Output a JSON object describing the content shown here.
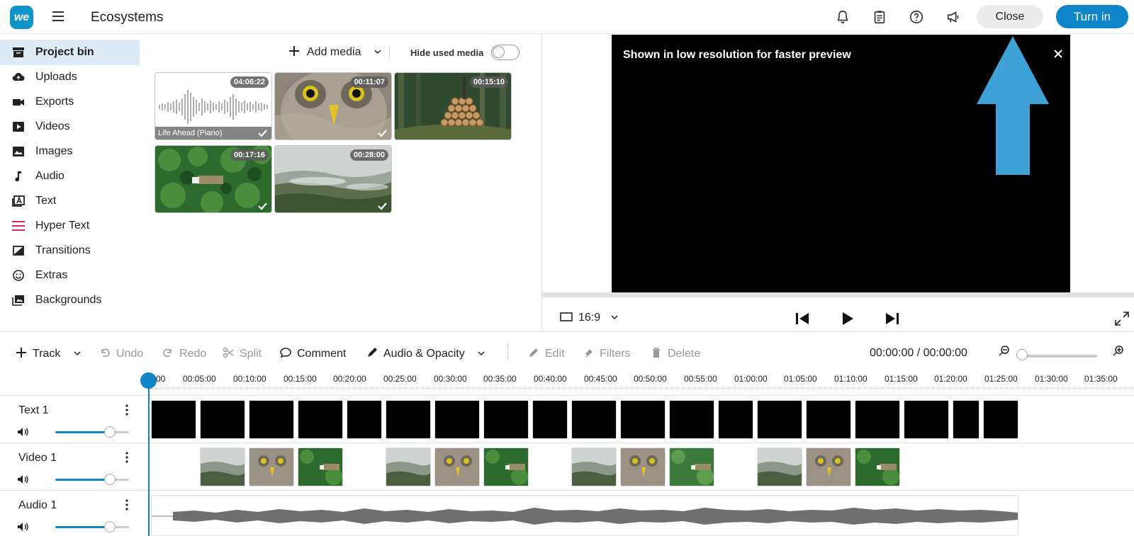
{
  "header": {
    "logo_text": "we",
    "project_title": "Ecosystems",
    "close_label": "Close",
    "turnin_label": "Turn in"
  },
  "sidebar": {
    "items": [
      {
        "label": "Project bin",
        "icon": "archive-icon"
      },
      {
        "label": "Uploads",
        "icon": "cloud-upload-icon"
      },
      {
        "label": "Exports",
        "icon": "video-camera-icon"
      },
      {
        "label": "Videos",
        "icon": "play-box-icon"
      },
      {
        "label": "Images",
        "icon": "image-icon"
      },
      {
        "label": "Audio",
        "icon": "music-note-icon"
      },
      {
        "label": "Text",
        "icon": "text-box-icon"
      },
      {
        "label": "Hyper Text",
        "icon": "hyper-text-icon"
      },
      {
        "label": "Transitions",
        "icon": "transition-icon"
      },
      {
        "label": "Extras",
        "icon": "smiley-icon"
      },
      {
        "label": "Backgrounds",
        "icon": "backgrounds-icon"
      }
    ]
  },
  "media_bin": {
    "add_media_label": "Add media",
    "hide_used_label": "Hide used media",
    "items": [
      {
        "duration": "04:06:22",
        "label": "Life Ahead (Piano)",
        "kind": "audio",
        "used": true
      },
      {
        "duration": "00:11:07",
        "label": "",
        "kind": "owl",
        "used": true
      },
      {
        "duration": "00:15:10",
        "label": "",
        "kind": "logs",
        "used": false
      },
      {
        "duration": "00:17:16",
        "label": "",
        "kind": "aerial-forest",
        "used": true
      },
      {
        "duration": "00:28:00",
        "label": "",
        "kind": "misty-forest",
        "used": true
      }
    ]
  },
  "preview": {
    "notice": "Shown in low resolution for faster preview",
    "aspect_ratio": "16:9"
  },
  "toolbar": {
    "track_label": "Track",
    "undo_label": "Undo",
    "redo_label": "Redo",
    "split_label": "Split",
    "comment_label": "Comment",
    "audio_opacity_label": "Audio & Opacity",
    "edit_label": "Edit",
    "filters_label": "Filters",
    "delete_label": "Delete",
    "timecode": "00:00:00 / 00:00:00"
  },
  "timeline": {
    "ticks": [
      "00",
      "00:05:00",
      "00:10:00",
      "00:15:00",
      "00:20:00",
      "00:25:00",
      "00:30:00",
      "00:35:00",
      "00:40:00",
      "00:45:00",
      "00:50:00",
      "00:55:00",
      "01:00:00",
      "01:05:00",
      "01:10:00",
      "01:15:00",
      "01:20:00",
      "01:25:00",
      "01:30:00",
      "01:35:00"
    ],
    "tracks": [
      {
        "name": "Text 1",
        "volume": 0.73
      },
      {
        "name": "Video 1",
        "volume": 0.73
      },
      {
        "name": "Audio 1",
        "volume": 0.73
      }
    ]
  },
  "colors": {
    "accent": "#0e84c9",
    "active_sidebar": "#dcebf5",
    "arrow": "#3fa2d6"
  }
}
